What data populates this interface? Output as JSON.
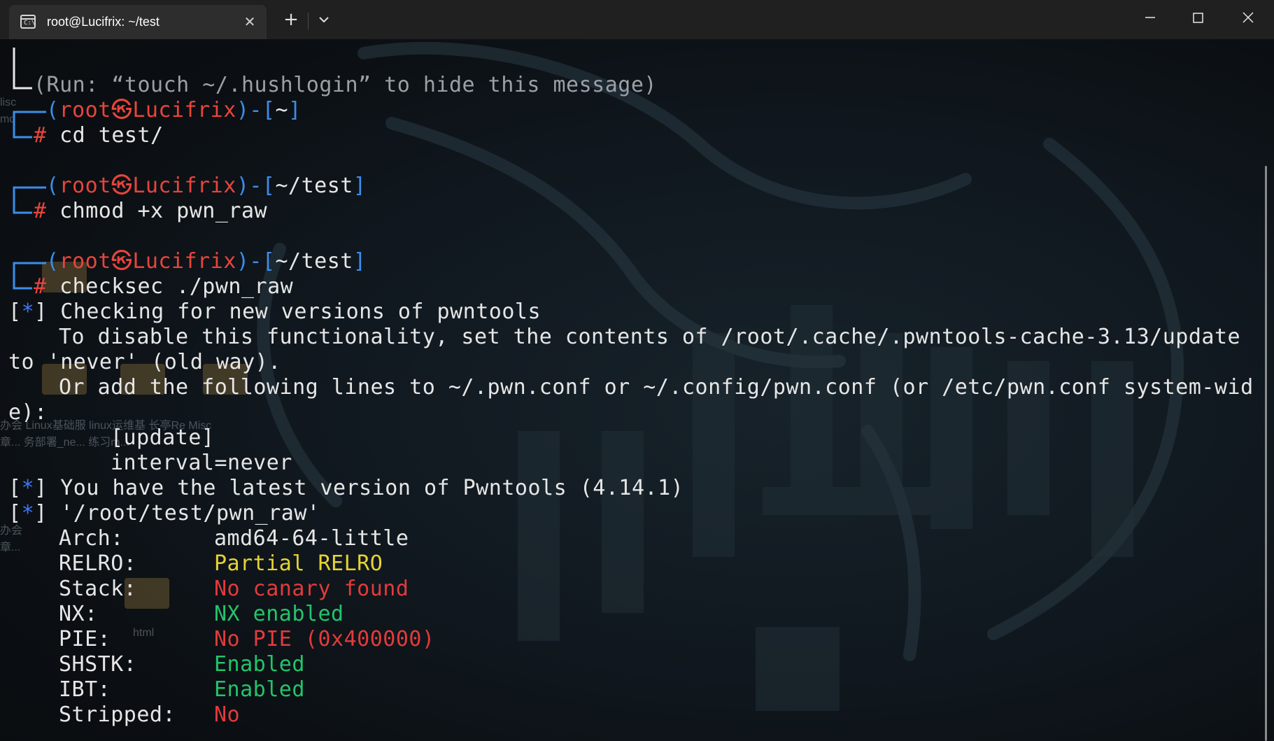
{
  "window": {
    "tab_title": "root@Lucifrix: ~/test",
    "tab_icon": "terminal-icon",
    "new_tab_label": "+",
    "close_tab_label": "✕"
  },
  "terminal": {
    "hushlogin_line": "(Run: “touch ~/.hushlogin” to hide this message)",
    "prompt_user": "root",
    "prompt_host": "Lucifrix",
    "prompt_symbol": "㉿",
    "prompt_dir_home": "~",
    "prompt_dir_test": "~/test",
    "cmd1": "cd test/",
    "cmd2": "chmod +x pwn_raw",
    "cmd3_a": "checksec",
    "cmd3_b": " ./pwn_raw",
    "star": "*",
    "out1": "Checking for new versions of pwntools",
    "out2": "To disable this functionality, set the contents of /root/.cache/.pwntools-cache-3.13/update",
    "out3": "to 'never' (old way).",
    "out4": "Or add the following lines to ~/.pwn.conf or ~/.config/pwn.conf (or /etc/pwn.conf system-wid",
    "out5": "e):",
    "out6": "[update]",
    "out7": "interval=never",
    "out8": "You have the latest version of Pwntools (4.14.1)",
    "out9": "'/root/test/pwn_raw'",
    "props": [
      {
        "key": "Arch:",
        "value": "amd64-64-little"
      },
      {
        "key": "RELRO:",
        "value": "Partial RELRO"
      },
      {
        "key": "Stack:",
        "value": "No canary found"
      },
      {
        "key": "NX:",
        "value": "NX enabled"
      },
      {
        "key": "PIE:",
        "value": "No PIE (0x400000)"
      },
      {
        "key": "SHSTK:",
        "value": "Enabled"
      },
      {
        "key": "IBT:",
        "value": "Enabled"
      },
      {
        "key": "Stripped:",
        "value": "No"
      }
    ]
  },
  "desktop_bleed": {
    "b1": "lisc",
    "b2": "md",
    "b3": "办会  Linux基础服   linux运维基   长亭Re Misc",
    "b4": "章...  务部署_ne...             练习m...",
    "b5": "html",
    "b6": "办会",
    "b7": "章..."
  },
  "colors": {
    "prompt_red": "#e8453c",
    "prompt_blue": "#3b8eea",
    "status_yellow": "#e5d334",
    "status_green": "#23c46b",
    "status_red": "#e23b3b",
    "text": "#e6e6e6",
    "dim_text": "#9aa0a6"
  }
}
